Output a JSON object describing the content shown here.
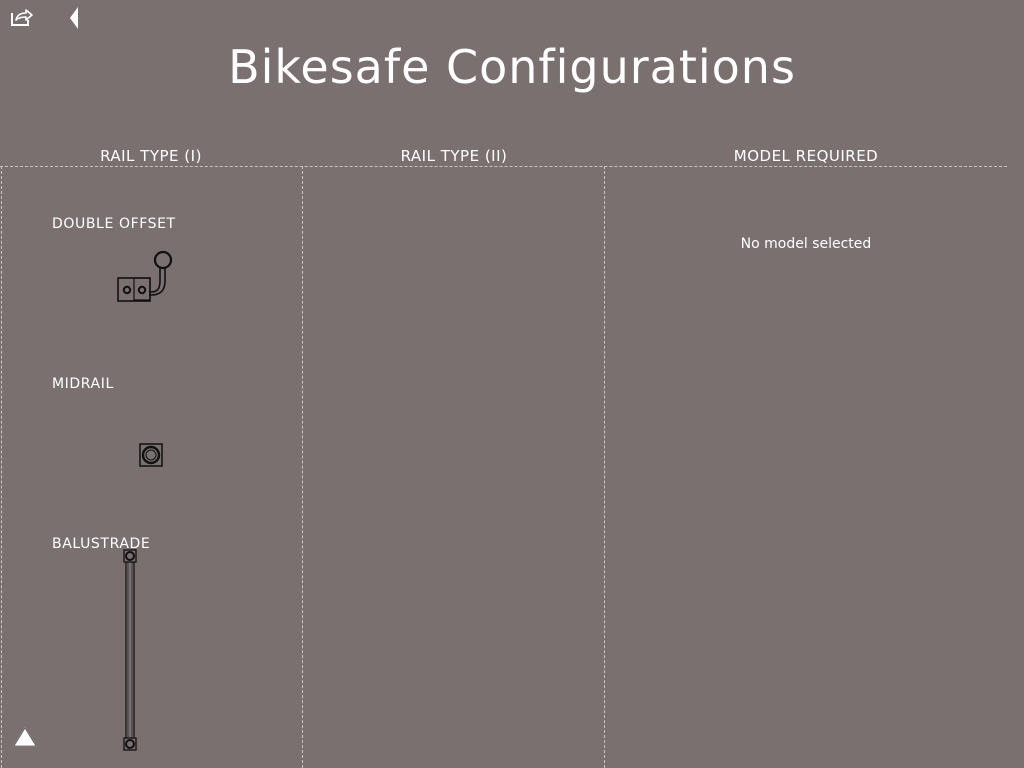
{
  "header": {
    "title": "Bikesafe Configurations",
    "share_icon": "share-icon",
    "back_icon": "back-arrow-icon"
  },
  "columns": [
    {
      "label": "RAIL TYPE (I)"
    },
    {
      "label": "RAIL TYPE (II)"
    },
    {
      "label": "MODEL REQUIRED"
    }
  ],
  "rail_types": [
    {
      "label": "DOUBLE OFFSET",
      "icon": "double-offset-rail-diagram"
    },
    {
      "label": "MIDRAIL",
      "icon": "midrail-diagram"
    },
    {
      "label": "BALUSTRADE",
      "icon": "balustrade-diagram"
    }
  ],
  "model": {
    "status": "No model selected"
  },
  "footer": {
    "icon": "triangle-up-icon"
  },
  "colors": {
    "background": "#7a7070",
    "text": "#ffffff",
    "divider": "#c9c3c3",
    "diagram_line": "#111111"
  }
}
